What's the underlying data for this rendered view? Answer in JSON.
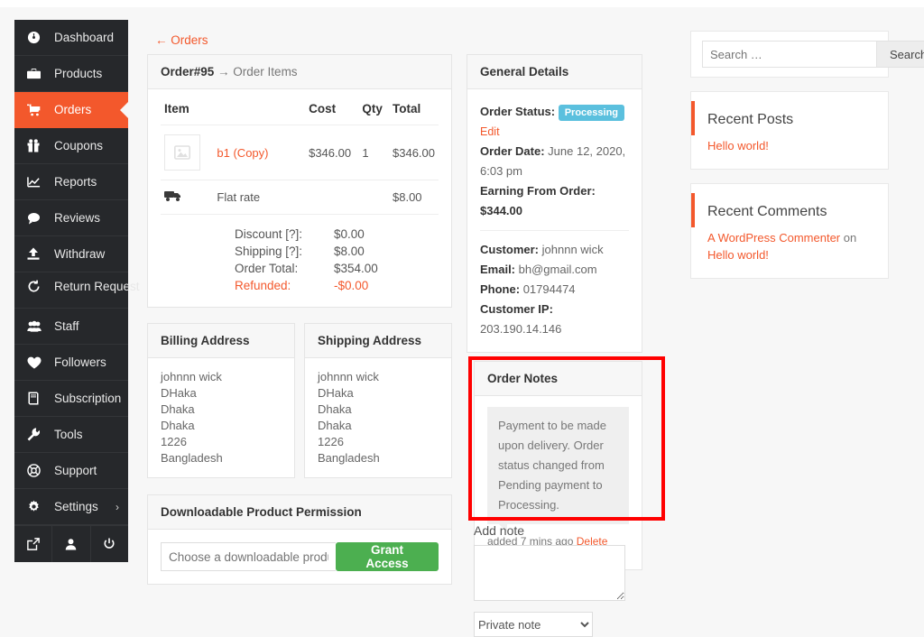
{
  "sidebar": {
    "items": [
      {
        "label": "Dashboard",
        "icon": "dashboard-icon"
      },
      {
        "label": "Products",
        "icon": "briefcase-icon"
      },
      {
        "label": "Orders",
        "icon": "cart-icon",
        "active": true
      },
      {
        "label": "Coupons",
        "icon": "gift-icon"
      },
      {
        "label": "Reports",
        "icon": "chart-icon"
      },
      {
        "label": "Reviews",
        "icon": "comment-icon"
      },
      {
        "label": "Withdraw",
        "icon": "upload-icon"
      },
      {
        "label": "Return Request",
        "icon": "refresh-icon"
      },
      {
        "label": "Staff",
        "icon": "users-icon"
      },
      {
        "label": "Followers",
        "icon": "heart-icon"
      },
      {
        "label": "Subscription",
        "icon": "book-icon"
      },
      {
        "label": "Tools",
        "icon": "wrench-icon"
      },
      {
        "label": "Support",
        "icon": "lifebuoy-icon"
      },
      {
        "label": "Settings",
        "icon": "gear-icon",
        "chevron": "›"
      }
    ],
    "footer": [
      {
        "icon": "external-link-icon"
      },
      {
        "icon": "user-icon"
      },
      {
        "icon": "power-icon"
      }
    ]
  },
  "back_link": "← Orders",
  "order_items": {
    "title_bold": "Order#95",
    "title_rest": " → Order Items",
    "columns": [
      "Item",
      "Cost",
      "Qty",
      "Total"
    ],
    "rows": [
      {
        "name": "b1 (Copy)",
        "cost": "$346.00",
        "qty": "1",
        "total": "$346.00",
        "thumb": "image-placeholder-icon"
      }
    ],
    "shipping_row": {
      "icon": "truck-icon",
      "label": "Flat rate",
      "amount": "$8.00"
    },
    "totals": [
      {
        "label": "Discount [?]:",
        "value": "$0.00"
      },
      {
        "label": "Shipping [?]:",
        "value": "$8.00"
      },
      {
        "label": "Order Total:",
        "value": "$354.00"
      }
    ],
    "refunded": {
      "label": "Refunded:",
      "value": "-$0.00"
    }
  },
  "billing": {
    "title": "Billing Address",
    "lines": [
      "johnnn wick",
      "DHaka",
      "Dhaka",
      "Dhaka",
      "1226",
      "Bangladesh"
    ]
  },
  "shipping": {
    "title": "Shipping Address",
    "lines": [
      "johnnn wick",
      "DHaka",
      "Dhaka",
      "Dhaka",
      "1226",
      "Bangladesh"
    ]
  },
  "downloadable": {
    "title": "Downloadable Product Permission",
    "placeholder": "Choose a downloadable product",
    "button": "Grant Access"
  },
  "general_details": {
    "title": "General Details",
    "order_status_label": "Order Status:",
    "order_status_value": "Processing",
    "edit_link": "Edit",
    "order_date_label": "Order Date:",
    "order_date_value": "June 12, 2020, 6:03 pm",
    "earning_label": "Earning From Order:",
    "earning_value": "$344.00",
    "customer_label": "Customer:",
    "customer_value": "johnnn wick",
    "email_label": "Email:",
    "email_value": "bh@gmail.com",
    "phone_label": "Phone:",
    "phone_value": "01794474",
    "ip_label": "Customer IP:",
    "ip_value": "203.190.14.146"
  },
  "order_notes": {
    "title": "Order Notes",
    "note_text": "Payment to be made upon delivery. Order status changed from Pending payment to Processing.",
    "meta_added": "added 7 mins ago",
    "delete_link": "Delete note"
  },
  "add_note": {
    "title": "Add note",
    "textarea_value": "",
    "select_value": "Private note"
  },
  "right_widgets": {
    "search": {
      "placeholder": "Search …",
      "button": "Search",
      "value": ""
    },
    "recent_posts": {
      "title": "Recent Posts",
      "items": [
        "Hello world!"
      ]
    },
    "recent_comments": {
      "title": "Recent Comments",
      "author": "A WordPress Commenter",
      "on": " on ",
      "post": "Hello world!"
    }
  },
  "colors": {
    "accent": "#f3582c",
    "sidebar_bg": "#26282b",
    "badge": "#5bc0de",
    "green": "#4caf50",
    "highlight": "#ff0000"
  }
}
